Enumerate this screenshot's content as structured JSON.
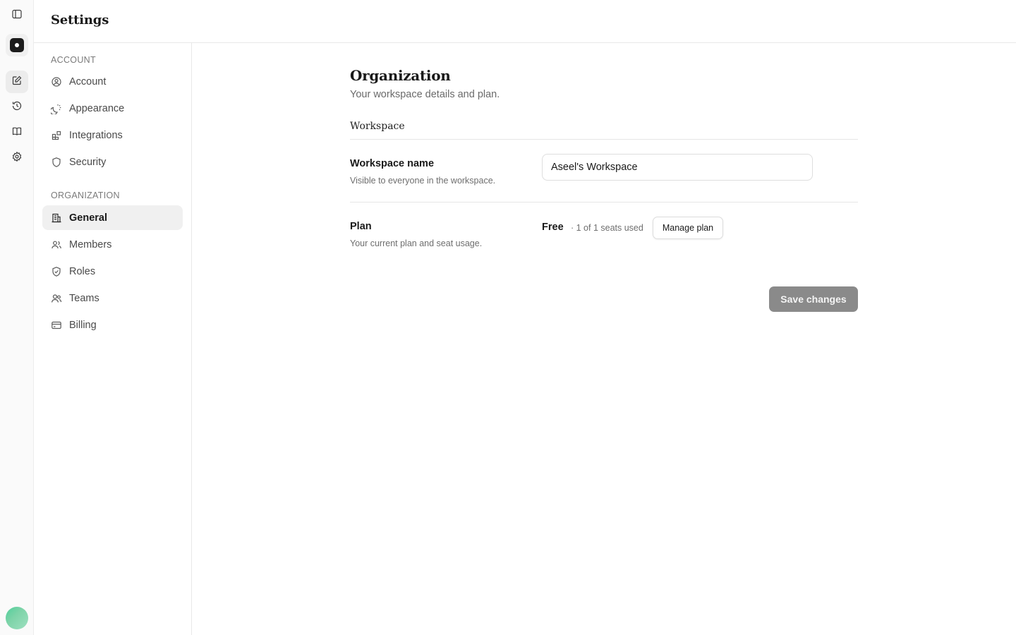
{
  "header": {
    "title": "Settings"
  },
  "rail": {
    "items": [
      {
        "icon": "sidebar-toggle-icon"
      },
      {
        "icon": "workspace-logo-icon"
      },
      {
        "icon": "compose-icon"
      },
      {
        "icon": "history-icon"
      },
      {
        "icon": "book-icon"
      },
      {
        "icon": "gear-icon"
      }
    ]
  },
  "sidebar": {
    "account_section": "ACCOUNT",
    "account_items": [
      {
        "label": "Account",
        "icon": "user-circle-icon"
      },
      {
        "label": "Appearance",
        "icon": "sun-moon-icon"
      },
      {
        "label": "Integrations",
        "icon": "blocks-icon"
      },
      {
        "label": "Security",
        "icon": "shield-icon"
      }
    ],
    "org_section": "ORGANIZATION",
    "org_items": [
      {
        "label": "General",
        "icon": "building-icon",
        "active": true
      },
      {
        "label": "Members",
        "icon": "users-icon"
      },
      {
        "label": "Roles",
        "icon": "shield-check-icon"
      },
      {
        "label": "Teams",
        "icon": "team-icon"
      },
      {
        "label": "Billing",
        "icon": "credit-card-icon"
      }
    ]
  },
  "main": {
    "title": "Organization",
    "subtitle": "Your workspace details and plan.",
    "section_heading": "Workspace",
    "workspace_name": {
      "label": "Workspace name",
      "description": "Visible to everyone in the workspace.",
      "value": "Aseel's Workspace"
    },
    "plan": {
      "label": "Plan",
      "description": "Your current plan and seat usage.",
      "name": "Free",
      "seats": "· 1 of 1 seats used",
      "manage_label": "Manage plan"
    },
    "save_label": "Save changes"
  },
  "colors": {
    "active_nav_bg": "#f0f0f0",
    "save_button_bg": "#8a8a8a",
    "border": "#e8e8e8"
  }
}
